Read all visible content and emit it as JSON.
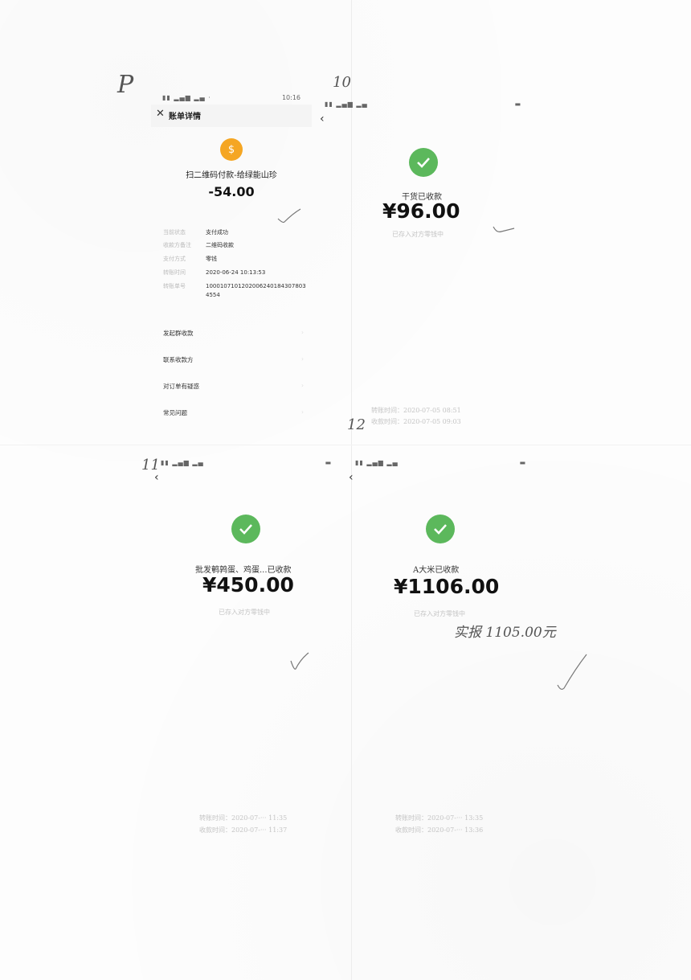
{
  "page_marks": {
    "p": "P",
    "n10": "10",
    "n11": "11",
    "n12": "12"
  },
  "panel1": {
    "status_time": "10:16",
    "title": "账单详情",
    "merchant": "扫二维码付款-给绿能山珍",
    "amount": "-54.00",
    "details": [
      {
        "key": "当前状态",
        "value": "支付成功"
      },
      {
        "key": "收款方备注",
        "value": "二维码收款"
      },
      {
        "key": "支付方式",
        "value": "零钱"
      },
      {
        "key": "转账时间",
        "value": "2020-06-24 10:13:53"
      },
      {
        "key": "转账单号",
        "value": "1000107101202006240184307803 4554"
      }
    ],
    "menu": [
      "发起群收款",
      "联系收款方",
      "对订单有疑惑",
      "常见问题"
    ]
  },
  "panel2": {
    "title": "干货已收款",
    "amount": "¥96.00",
    "sub": "已存入对方零钱中",
    "transfer_time": "转账时间：2020-07-05 08:51",
    "receive_time": "收款时间：2020-07-05 09:03"
  },
  "panel3": {
    "title": "批发鹌鹑蛋、鸡蛋...已收款",
    "amount": "¥450.00",
    "sub": "已存入对方零钱中",
    "transfer_time": "转账时间：2020-07-··· 11:35",
    "receive_time": "收款时间：2020-07-··· 11:37"
  },
  "panel4": {
    "title": "A大米已收款",
    "amount": "¥1106.00",
    "sub": "已存入对方零钱中",
    "note": "实报 1105.00元",
    "transfer_time": "转账时间：2020-07-··· 13:35",
    "receive_time": "收款时间：2020-07-··· 13:36"
  },
  "icons": {
    "check": "check-icon",
    "bag": "money-bag-icon",
    "back": "chevron-left-icon",
    "close": "close-icon"
  },
  "colors": {
    "check_green": "#5cb85c",
    "bag_orange": "#f5a623"
  }
}
